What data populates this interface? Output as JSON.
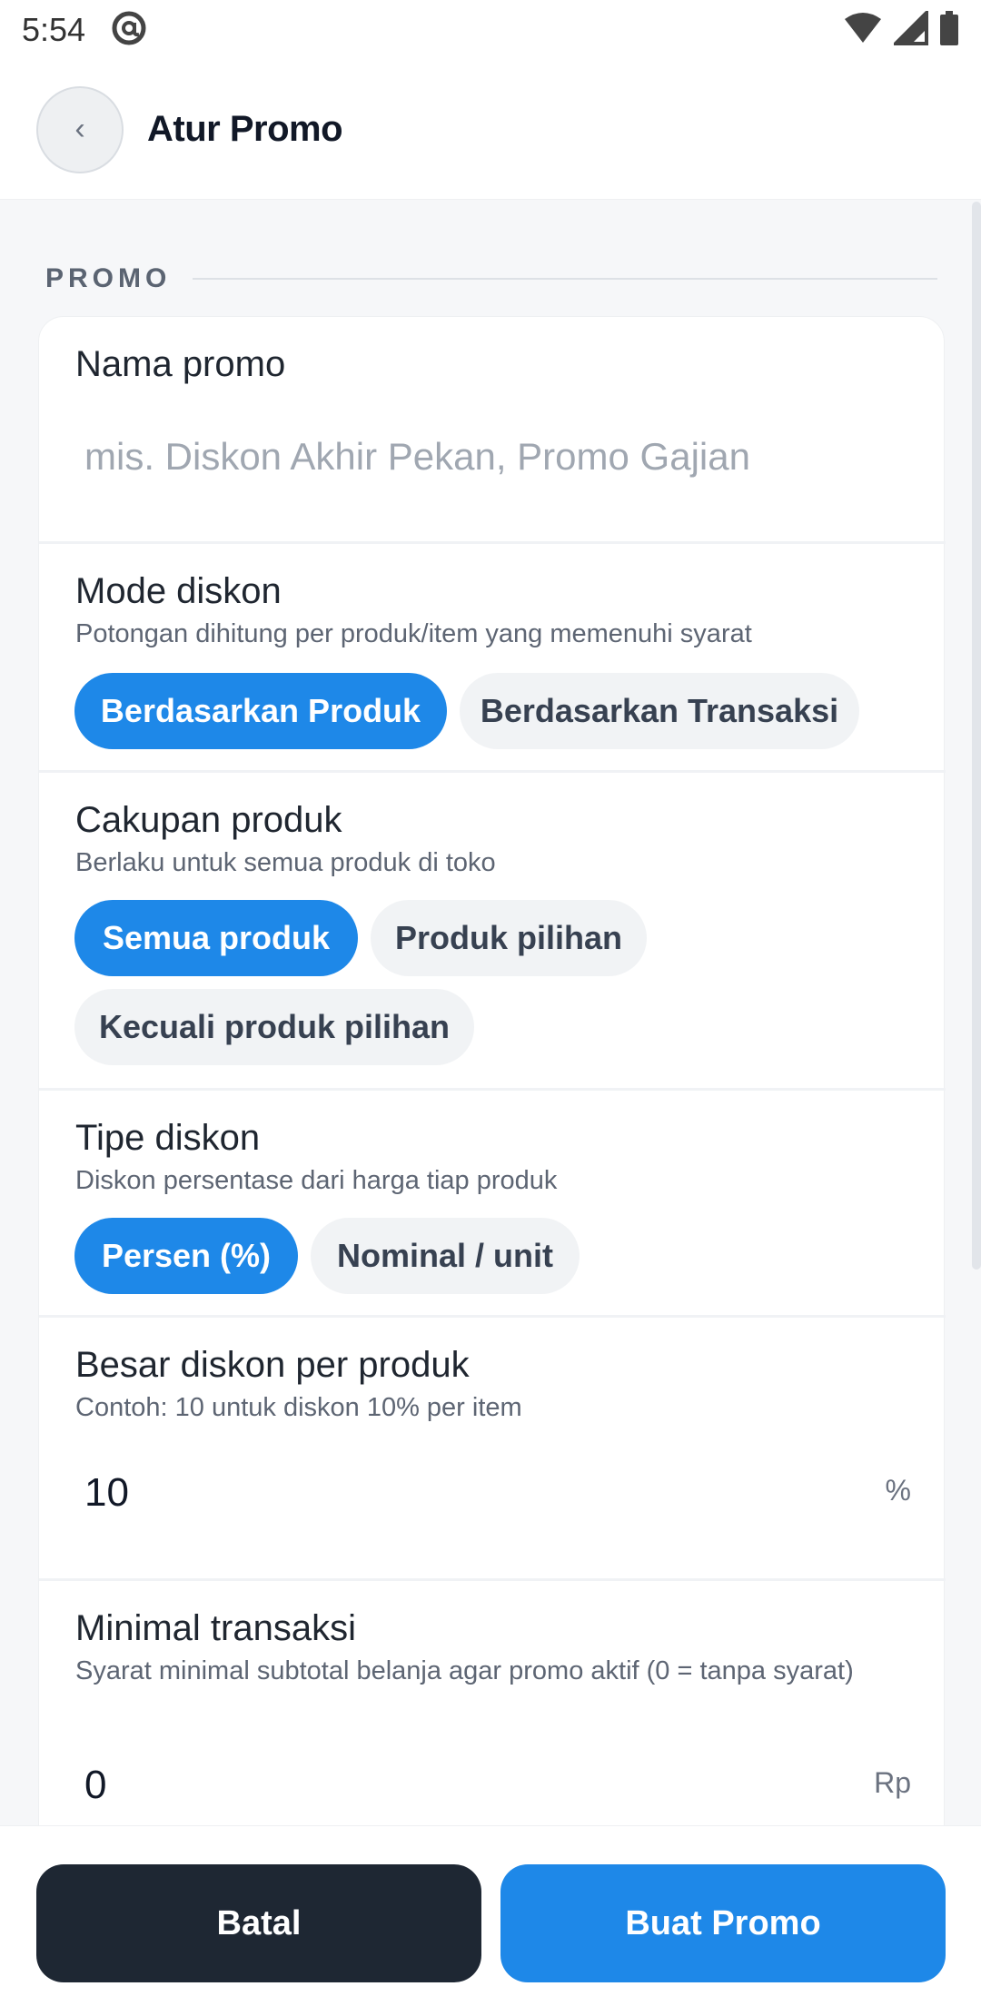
{
  "status": {
    "time": "5:54"
  },
  "header": {
    "title": "Atur Promo"
  },
  "section": {
    "title": "PROMO"
  },
  "fields": {
    "name": {
      "label": "Nama promo",
      "placeholder": "mis. Diskon Akhir Pekan, Promo Gajian"
    },
    "mode": {
      "label": "Mode diskon",
      "help": "Potongan dihitung per produk/item yang memenuhi syarat",
      "options": [
        "Berdasarkan Produk",
        "Berdasarkan Transaksi"
      ],
      "selected": "Berdasarkan Produk"
    },
    "scope": {
      "label": "Cakupan produk",
      "help": "Berlaku untuk semua produk di toko",
      "options": [
        "Semua produk",
        "Produk pilihan",
        "Kecuali produk pilihan"
      ],
      "selected": "Semua produk"
    },
    "type": {
      "label": "Tipe diskon",
      "help": "Diskon persentase dari harga tiap produk",
      "options": [
        "Persen (%)",
        "Nominal / unit"
      ],
      "selected": "Persen (%)"
    },
    "amount": {
      "label": "Besar diskon per produk",
      "help": "Contoh: 10 untuk diskon 10% per item",
      "value": "10",
      "unit": "%"
    },
    "min": {
      "label": "Minimal transaksi",
      "help": "Syarat minimal subtotal belanja agar promo aktif (0 = tanpa syarat)",
      "value": "0",
      "unit": "Rp"
    }
  },
  "actions": {
    "cancel": "Batal",
    "submit": "Buat Promo"
  },
  "colors": {
    "accent": "#1e88e8",
    "dark": "#1e2733"
  }
}
